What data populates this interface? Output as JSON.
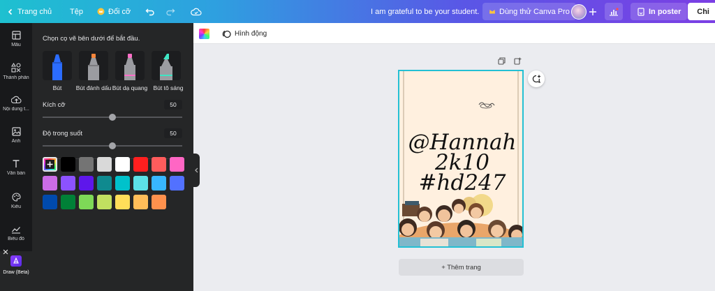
{
  "topbar": {
    "home_label": "Trang chủ",
    "file_label": "Tệp",
    "resize_label": "Đổi cỡ",
    "doc_title": "I am grateful to be your student.",
    "try_pro_label": "Dùng thử Canva Pro",
    "print_label": "In poster",
    "share_label": "Chi"
  },
  "rail": {
    "items": [
      "Mẫu",
      "Thành phần",
      "Nội dung t...",
      "Ảnh",
      "Văn bản",
      "Kiểu",
      "Biểu đồ"
    ],
    "active_label": "Draw (Beta)"
  },
  "panel": {
    "intro": "Chọn cọ vẽ bên dưới để bắt đầu.",
    "brushes": [
      {
        "label": "Bút",
        "color": "#2b6cff"
      },
      {
        "label": "Bút đánh dấu",
        "color": "#f7853a"
      },
      {
        "label": "Bút dạ quang",
        "color": "#ff6fc8"
      },
      {
        "label": "Bút tô sáng",
        "color": "#3ee6c4"
      }
    ],
    "size_label": "Kích cỡ",
    "size_value": "50",
    "size_level": 0.5,
    "opacity_label": "Độ trong suốt",
    "opacity_value": "50",
    "opacity_level": 0.5,
    "colors": [
      "#000000",
      "#747474",
      "#d9d9d9",
      "#ffffff",
      "#ff1f1f",
      "#ff5c5c",
      "#ff66c4",
      "#cb6ce6",
      "#8c52ff",
      "#5e17eb",
      "#0f8a8f",
      "#00c2cb",
      "#5ce1e6",
      "#38b6ff",
      "#5271ff",
      "#004aad",
      "#008037",
      "#7ed957",
      "#c1e060",
      "#ffde59",
      "#ffbd59",
      "#ff914d"
    ]
  },
  "toolbar": {
    "animate_label": "Hình động"
  },
  "canvas": {
    "text_line1": "@Hannah",
    "text_line2": "2k10",
    "text_line3": "#hd247",
    "add_page_label": "+ Thêm trang"
  }
}
